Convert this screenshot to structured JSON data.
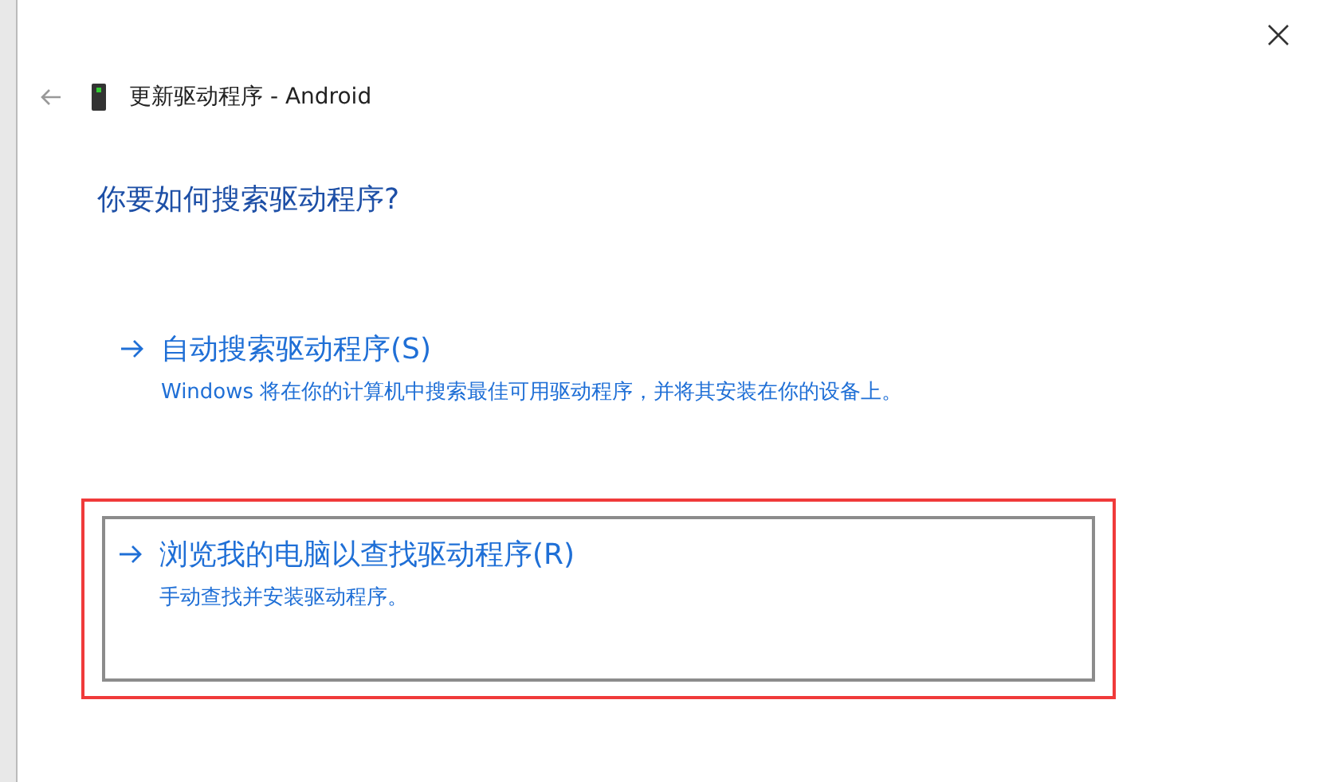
{
  "window": {
    "title": "更新驱动程序 - Android"
  },
  "heading": "你要如何搜索驱动程序?",
  "options": [
    {
      "title": "自动搜索驱动程序(S)",
      "description": "Windows 将在你的计算机中搜索最佳可用驱动程序，并将其安装在你的设备上。",
      "focused": false,
      "highlighted": false
    },
    {
      "title": "浏览我的电脑以查找驱动程序(R)",
      "description": "手动查找并安装驱动程序。",
      "focused": true,
      "highlighted": true
    }
  ]
}
